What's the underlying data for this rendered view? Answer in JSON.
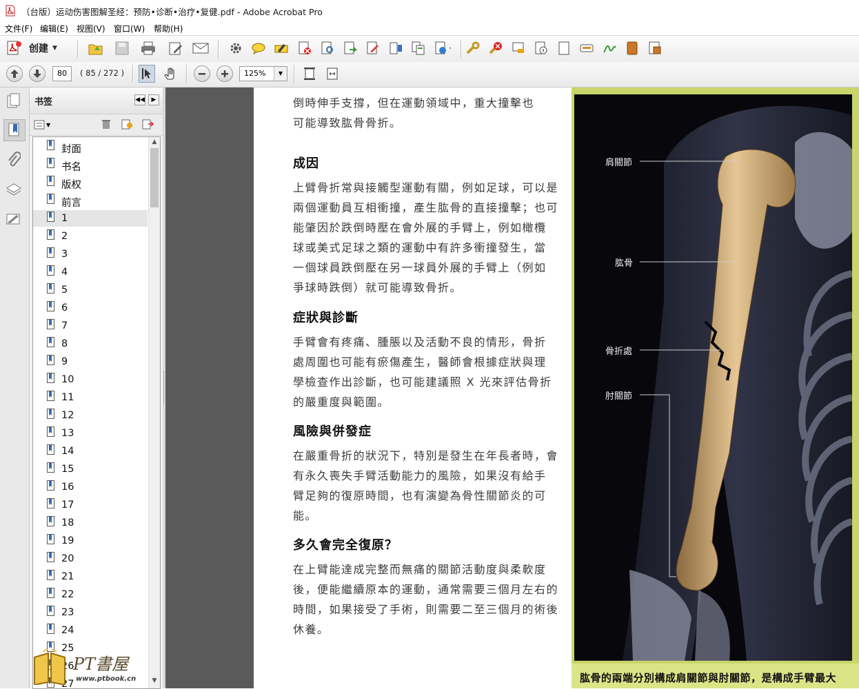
{
  "window": {
    "title": "（台版）运动伤害图解圣经：预防•诊断•治疗•复健.pdf - Adobe Acrobat Pro"
  },
  "menu": {
    "items": [
      "文件(F)",
      "编辑(E)",
      "视图(V)",
      "窗口(W)",
      "帮助(H)"
    ]
  },
  "toolbar": {
    "create_label": "创建",
    "icons": [
      "open-icon",
      "save-icon",
      "print-icon",
      "edit-icon",
      "email-icon",
      "settings-icon",
      "comment-icon",
      "highlight-icon",
      "delete-page-icon",
      "scan-icon",
      "export-icon",
      "form-icon",
      "organize-icon",
      "combine-icon",
      "share-icon",
      "lock-icon",
      "unlock-icon",
      "stamp-icon",
      "info-icon",
      "page-icon",
      "redact-icon",
      "sign-icon",
      "book-icon",
      "more-icon"
    ]
  },
  "navbar": {
    "page_value": "80",
    "page_info": "( 85 / 272 )",
    "zoom_value": "125%"
  },
  "bookmarks": {
    "title": "书签",
    "items": [
      "封面",
      "书名",
      "版权",
      "前言",
      "1",
      "2",
      "3",
      "4",
      "5",
      "6",
      "7",
      "8",
      "9",
      "10",
      "11",
      "12",
      "13",
      "14",
      "15",
      "16",
      "17",
      "18",
      "19",
      "20",
      "21",
      "22",
      "23",
      "24",
      "25",
      "26",
      "27"
    ],
    "selected_index": 4
  },
  "document": {
    "intro_lines": [
      "倒時伸手支撐，但在運動領域中，重大撞擊也",
      "可能導致肱骨骨折。"
    ],
    "sections": [
      {
        "heading": "成因",
        "lines": [
          "上臂骨折常與接觸型運動有關，例如足球，可以是",
          "兩個運動員互相衝撞，產生肱骨的直接撞擊；也可",
          "能肇因於跌倒時壓在會外展的手臂上，例如橄欖",
          "球或美式足球之類的運動中有許多衝撞發生，當",
          "一個球員跌倒壓在另一球員外展的手臂上（例如",
          "爭球時跌倒）就可能導致骨折。"
        ]
      },
      {
        "heading": "症狀與診斷",
        "lines": [
          "手臂會有疼痛、腫脹以及活動不良的情形，骨折",
          "處周圍也可能有瘀傷產生，醫師會根據症狀與理",
          "學檢查作出診斷，也可能建議照 X 光來評估骨折",
          "的嚴重度與範圍。"
        ]
      },
      {
        "heading": "風險與併發症",
        "lines": [
          "在嚴重骨折的狀況下，特別是發生在年長者時，會",
          "有永久喪失手臂活動能力的風險，如果沒有給手",
          "臂足夠的復原時間，也有演變為骨性關節炎的可",
          "能。"
        ]
      },
      {
        "heading": "多久會完全復原？",
        "lines": [
          "在上臂能達成完整而無痛的關節活動度與柔軟度",
          "後，便能繼續原本的運動，通常需要三個月左右的",
          "時間，如果接受了手術，則需要二至三個月的術後",
          "休養。"
        ]
      }
    ],
    "illustration": {
      "labels": [
        "肩關節",
        "肱骨",
        "骨折處",
        "肘關節"
      ],
      "caption": "肱骨的兩端分別構成肩關節與肘關節，是構成手臂最大"
    }
  },
  "watermark": {
    "text": "PT書屋",
    "url": "www.ptbook.cn"
  }
}
